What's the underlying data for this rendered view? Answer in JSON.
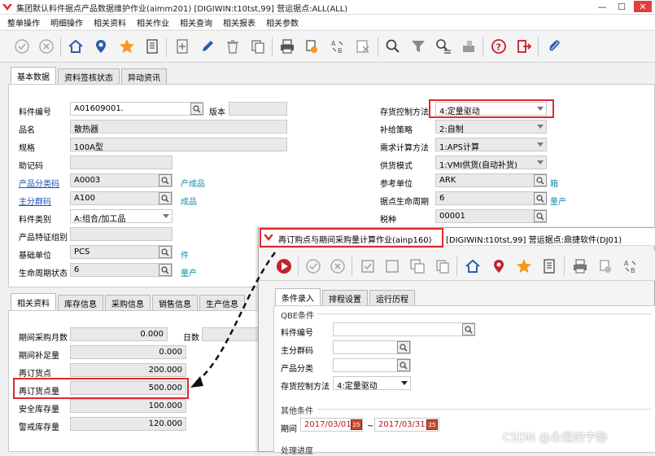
{
  "window": {
    "title": "集团默认料件据点产品数据维护作业(aimm201)    [DIGIWIN:t10tst,99]    营运据点:ALL(ALL)"
  },
  "menu": [
    "整单操作",
    "明细操作",
    "相关资料",
    "相关作业",
    "相关查询",
    "相关报表",
    "相关参数"
  ],
  "toolbar_icons": [
    "check-icon",
    "cancel-icon",
    "home-icon",
    "location-pin-icon",
    "star-icon",
    "list-icon",
    "add-icon",
    "edit-icon",
    "delete-icon",
    "copy-icon",
    "print-icon",
    "report-icon",
    "transfer-icon",
    "export-icon",
    "search-icon",
    "filter-icon",
    "query-icon",
    "clear-icon",
    "help-icon",
    "exit-icon",
    "attach-icon"
  ],
  "top_tabs": [
    "基本数据",
    "资料签核状态",
    "异动资讯"
  ],
  "basic": {
    "item_no_label": "料件编号",
    "item_no": "A01609001.",
    "version_label": "版本",
    "version": "",
    "name_label": "品名",
    "name": "散热器",
    "spec_label": "规格",
    "spec": "100A型",
    "mnemonic_label": "助记码",
    "mnemonic": "",
    "product_category_label": "产品分类码",
    "product_category": "A0003",
    "product_category_desc": "产成品",
    "main_group_label": "主分群码",
    "main_group": "A100",
    "main_group_desc": "成品",
    "item_type_label": "料件类别",
    "item_type": "A:组合/加工品",
    "feature_group_label": "产品特征组别",
    "feature_group": "",
    "base_unit_label": "基础单位",
    "base_unit": "PCS",
    "base_unit_desc": "件",
    "lifecycle_label": "生命周期状态",
    "lifecycle": "6",
    "lifecycle_desc": "量产"
  },
  "right": {
    "inv_control_label": "存货控制方法",
    "inv_control": "4:定量驱动",
    "supply_policy_label": "补给策略",
    "supply_policy": "2:自制",
    "demand_calc_label": "需求计算方法",
    "demand_calc": "1:APS计算",
    "supply_mode_label": "供货模式",
    "supply_mode": "1:VMI供货(自动补货)",
    "ref_unit_label": "参考单位",
    "ref_unit": "ARK",
    "ref_unit_desc": "箱",
    "site_lifecycle_label": "据点生命周期",
    "site_lifecycle": "6",
    "site_lifecycle_desc": "量产",
    "tax_label": "税种",
    "tax": "00001"
  },
  "bottom_tabs": [
    "相关资料",
    "库存信息",
    "采购信息",
    "销售信息",
    "生产信息"
  ],
  "related": {
    "purchase_months_label": "期间采购月数",
    "purchase_months": "0.000",
    "days_label": "日数",
    "period_supply_label": "期间补足量",
    "period_supply": "0.000",
    "reorder_point_label": "再订货点",
    "reorder_point": "200.000",
    "reorder_qty_label": "再订货点量",
    "reorder_qty": "500.000",
    "safety_stock_label": "安全库存量",
    "safety_stock": "100.000",
    "warning_stock_label": "警戒库存量",
    "warning_stock": "120.000"
  },
  "popup": {
    "title": "再订购点与期间采购量计算作业(ainp160)",
    "title_rest": "[DIGIWIN:t10tst,99]    营运据点:鼎捷软件(DJ01)",
    "tabs": [
      "条件录入",
      "排程设置",
      "运行历程"
    ],
    "qbe_label": "QBE条件",
    "item_no_label": "料件编号",
    "main_group_label": "主分群码",
    "product_category_label": "产品分类",
    "inv_control_label": "存货控制方法",
    "inv_control": "4:定量驱动",
    "other_label": "其他条件",
    "period_label": "期间",
    "date_from": "2017/03/01",
    "date_sep": "~",
    "date_to": "2017/03/31",
    "progress_label": "处理进度"
  },
  "watermark": "CSDN @永恒的宁静"
}
